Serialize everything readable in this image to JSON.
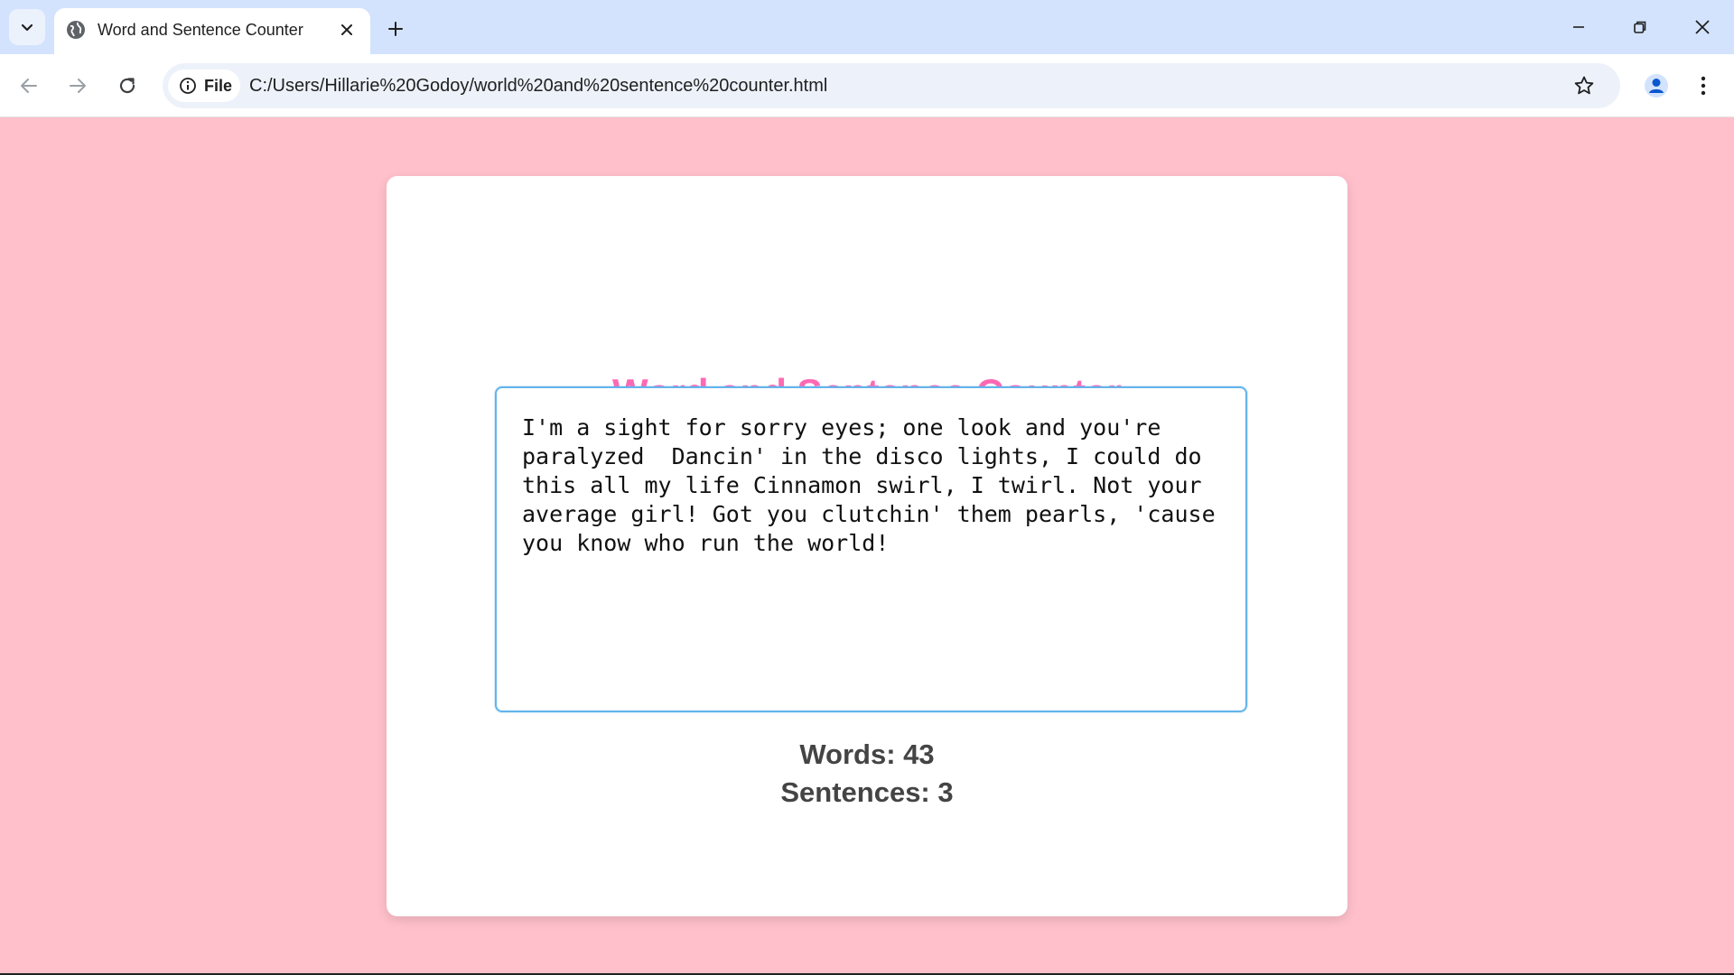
{
  "browser": {
    "tab": {
      "title": "Word and Sentence Counter"
    },
    "address_bar": {
      "chip_label": "File",
      "url": "C:/Users/Hillarie%20Godoy/world%20and%20sentence%20counter.html"
    }
  },
  "app": {
    "title": "Word and Sentence Counter",
    "input_text": "I'm a sight for sorry eyes; one look and you're paralyzed  Dancin' in the disco lights, I could do this all my life Cinnamon swirl, I twirl. Not your average girl! Got you clutchin' them pearls, 'cause you know who run the world!",
    "words_label": "Words: 43",
    "sentences_label": "Sentences: 3"
  },
  "colors": {
    "page_background": "#ffc0cb",
    "title_accent": "#ff69b4",
    "input_border": "#64b4ec",
    "tabstrip": "#d3e3fd"
  }
}
